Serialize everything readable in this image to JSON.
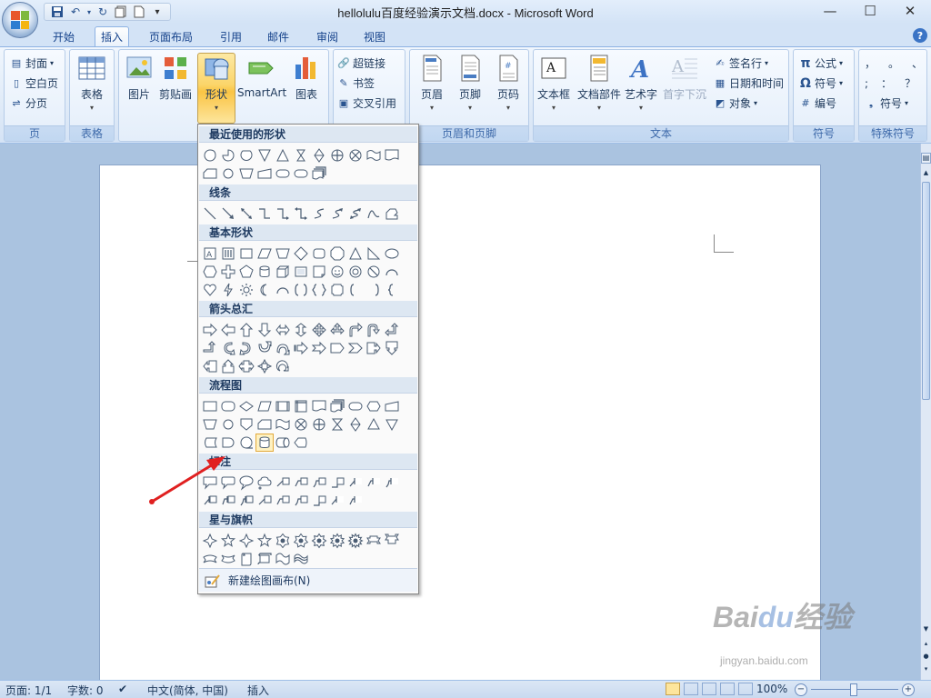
{
  "window": {
    "title": "hellolulu百度经验演示文档.docx - Microsoft Word",
    "minimize": "—",
    "maximize": "☐",
    "close": "✕"
  },
  "qat": {
    "items": [
      {
        "name": "save-icon",
        "glyph": "💾"
      },
      {
        "name": "undo-icon",
        "glyph": "↶"
      },
      {
        "name": "redo-icon",
        "glyph": "↻"
      },
      {
        "name": "copy-icon",
        "glyph": "❐"
      },
      {
        "name": "new-doc-icon",
        "glyph": "▯"
      },
      {
        "name": "customize-icon",
        "glyph": "▾"
      }
    ]
  },
  "tabs": [
    {
      "label": "开始"
    },
    {
      "label": "插入"
    },
    {
      "label": "页面布局"
    },
    {
      "label": "引用"
    },
    {
      "label": "邮件"
    },
    {
      "label": "审阅"
    },
    {
      "label": "视图"
    }
  ],
  "help": "?",
  "ribbon": {
    "pages": {
      "label": "页",
      "cover": "封面",
      "blank": "空白页",
      "break": "分页"
    },
    "tables": {
      "label": "表格",
      "table": "表格"
    },
    "illustrations": {
      "picture": "图片",
      "clipart": "剪贴画",
      "shapes": "形状",
      "smartart": "SmartArt",
      "chart": "图表"
    },
    "links": {
      "hyperlink": "超链接",
      "bookmark": "书签",
      "crossref": "交叉引用"
    },
    "headerfooter": {
      "label": "页眉和页脚",
      "header": "页眉",
      "footer": "页脚",
      "pagenum": "页码"
    },
    "text": {
      "label": "文本",
      "textbox": "文本框",
      "quickparts": "文档部件",
      "wordart": "艺术字",
      "dropcap": "首字下沉",
      "signature": "签名行",
      "datetime": "日期和时间",
      "object": "对象"
    },
    "symbols": {
      "label": "符号",
      "equation": "公式",
      "symbol": "符号",
      "number": "编号",
      "pi": "π",
      "omega": "Ω"
    },
    "special": {
      "label": "特殊符号",
      "chars": [
        "，",
        "。",
        "、",
        ";",
        "：",
        "？"
      ],
      "symbol": "符号"
    }
  },
  "gallery": {
    "categories": [
      {
        "id": "recent",
        "label": "最近使用的形状"
      },
      {
        "id": "lines",
        "label": "线条"
      },
      {
        "id": "basic",
        "label": "基本形状"
      },
      {
        "id": "arrows",
        "label": "箭头总汇"
      },
      {
        "id": "flowchart",
        "label": "流程图"
      },
      {
        "id": "callouts",
        "label": "标注"
      },
      {
        "id": "stars",
        "label": "星与旗帜"
      }
    ],
    "new_canvas": "新建绘图画布(N)"
  },
  "status": {
    "page": "页面: 1/1",
    "words": "字数: 0",
    "language": "中文(简体, 中国)",
    "mode": "插入",
    "zoom": "100%"
  },
  "watermark": {
    "brand": "Baidu经验",
    "url": "jingyan.baidu.com"
  }
}
